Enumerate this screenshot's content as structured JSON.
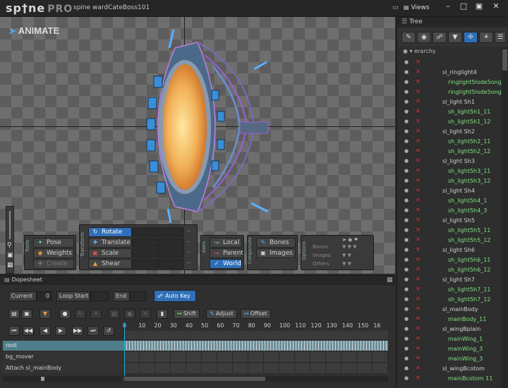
{
  "app": {
    "logo": "sp†ne",
    "logo_pro": "PRO",
    "project": "spine wardCateBoss101",
    "views_label": "Views"
  },
  "viewport": {
    "mode_label": "ANIMATE"
  },
  "tools": {
    "group_label": "Tools",
    "items": [
      {
        "label": "Pose",
        "on": false
      },
      {
        "label": "Weights",
        "on": false
      },
      {
        "label": "Create",
        "on": false
      }
    ]
  },
  "transform": {
    "group_label": "Transform",
    "items": [
      {
        "label": "Rotate",
        "on": true
      },
      {
        "label": "Translate",
        "on": false
      },
      {
        "label": "Scale",
        "on": false
      },
      {
        "label": "Shear",
        "on": false
      }
    ]
  },
  "axes": {
    "group_label": "Axes",
    "items": [
      {
        "label": "Local",
        "on": false
      },
      {
        "label": "Parent",
        "on": false
      },
      {
        "label": "World",
        "on": true
      }
    ]
  },
  "compensate": {
    "group_label": "Compensate",
    "items": [
      {
        "label": "Bones"
      },
      {
        "label": "Images"
      }
    ]
  },
  "options": {
    "group_label": "Options",
    "items": [
      {
        "label": "Bones"
      },
      {
        "label": "Images"
      },
      {
        "label": "Others"
      }
    ]
  },
  "tree": {
    "title": "Tree",
    "root_label": "erarchy",
    "rows": [
      {
        "label": "",
        "indent": 74,
        "green": true
      },
      {
        "label": "sl_ringlight4",
        "indent": 64,
        "green": false
      },
      {
        "label": "ringlight5lode5ongr5",
        "indent": 72,
        "green": true
      },
      {
        "label": "ringlight5lode5ongr5",
        "indent": 72,
        "green": true
      },
      {
        "label": "sl_light Sh1",
        "indent": 64,
        "green": false
      },
      {
        "label": "sh_light5h1_11",
        "indent": 72,
        "green": true
      },
      {
        "label": "sh_light5h1_12",
        "indent": 72,
        "green": true
      },
      {
        "label": "sl_light Sh2",
        "indent": 64,
        "green": false
      },
      {
        "label": "sh_light5h2_11",
        "indent": 72,
        "green": true
      },
      {
        "label": "sh_light5h2_12",
        "indent": 72,
        "green": true
      },
      {
        "label": "sl_light Sh3",
        "indent": 64,
        "green": false
      },
      {
        "label": "sh_light5h3_11",
        "indent": 72,
        "green": true
      },
      {
        "label": "sh_light5h3_12",
        "indent": 72,
        "green": true
      },
      {
        "label": "sl_light Sh4",
        "indent": 64,
        "green": false
      },
      {
        "label": "sh_light5h4_1",
        "indent": 72,
        "green": true
      },
      {
        "label": "sh_light5h4_3",
        "indent": 72,
        "green": true
      },
      {
        "label": "sl_light Sh5",
        "indent": 64,
        "green": false
      },
      {
        "label": "sh_light5h5_11",
        "indent": 72,
        "green": true
      },
      {
        "label": "sh_light5h5_12",
        "indent": 72,
        "green": true
      },
      {
        "label": "sl_light Sh6",
        "indent": 64,
        "green": false
      },
      {
        "label": "sh_light5h6_11",
        "indent": 72,
        "green": true
      },
      {
        "label": "sh_light5h6_12",
        "indent": 72,
        "green": true
      },
      {
        "label": "sl_light Sh7",
        "indent": 64,
        "green": false
      },
      {
        "label": "sh_light5h7_11",
        "indent": 72,
        "green": true
      },
      {
        "label": "sh_light5h7_12",
        "indent": 72,
        "green": true
      },
      {
        "label": "sl_mainBody",
        "indent": 64,
        "green": false
      },
      {
        "label": "mainBody_11",
        "indent": 72,
        "green": true
      },
      {
        "label": "sl_wingBplain",
        "indent": 64,
        "green": false
      },
      {
        "label": "mainWing_1",
        "indent": 72,
        "green": true
      },
      {
        "label": "mainWing_3",
        "indent": 72,
        "green": true
      },
      {
        "label": "mainWing_3",
        "indent": 72,
        "green": true
      },
      {
        "label": "sl_wingBcotom",
        "indent": 64,
        "green": false
      },
      {
        "label": "mainBcotom 11",
        "indent": 72,
        "green": true
      }
    ]
  },
  "dopesheet": {
    "title": "Dopesheet",
    "current_label": "Current",
    "current_value": "0",
    "loop_start_label": "Loop Start",
    "end_label": "End",
    "autokey_label": "Auto Key",
    "shift_label": "Shift",
    "adjust_label": "Adjust",
    "offset_label": "Offset",
    "ruler": [
      "0",
      "10",
      "20",
      "30",
      "40",
      "50",
      "60",
      "70",
      "80",
      "90",
      "100",
      "110",
      "120",
      "130",
      "140",
      "150",
      "16"
    ],
    "tracks": [
      {
        "label": "root",
        "selected": true
      },
      {
        "label": "bg_mover",
        "selected": false
      },
      {
        "label": "Attach  sl_mainBody",
        "selected": false
      }
    ]
  }
}
